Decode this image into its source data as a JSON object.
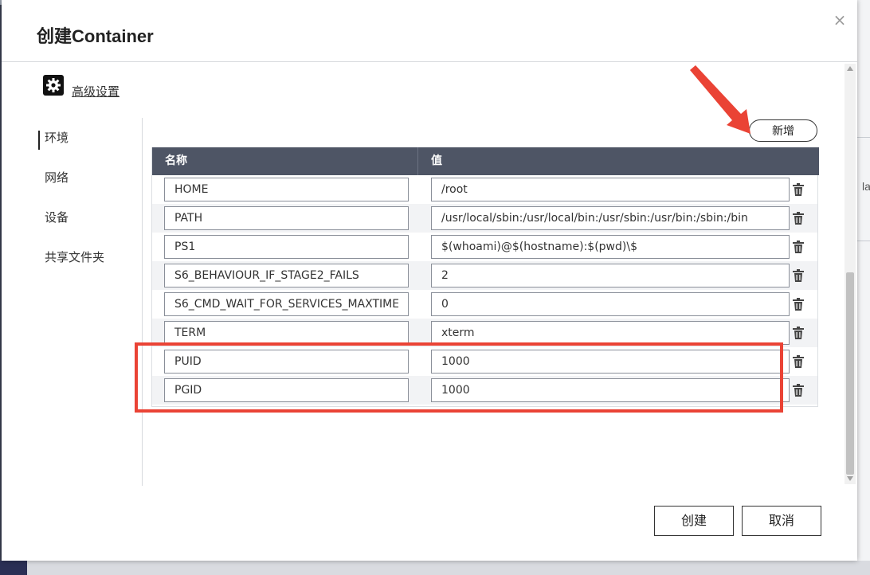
{
  "dialog": {
    "title": "创建Container",
    "close_label": "×"
  },
  "advanced": {
    "label": "高级设置",
    "icon": "gear-icon"
  },
  "sidebar": {
    "items": [
      {
        "label": "环境",
        "active": true
      },
      {
        "label": "网络",
        "active": false
      },
      {
        "label": "设备",
        "active": false
      },
      {
        "label": "共享文件夹",
        "active": false
      }
    ]
  },
  "env": {
    "add_label": "新增",
    "columns": {
      "name": "名称",
      "value": "值"
    },
    "rows": [
      {
        "name": "HOME",
        "value": "/root"
      },
      {
        "name": "PATH",
        "value": "/usr/local/sbin:/usr/local/bin:/usr/sbin:/usr/bin:/sbin:/bin"
      },
      {
        "name": "PS1",
        "value": "$(whoami)@$(hostname):$(pwd)\\$"
      },
      {
        "name": "S6_BEHAVIOUR_IF_STAGE2_FAILS",
        "value": "2"
      },
      {
        "name": "S6_CMD_WAIT_FOR_SERVICES_MAXTIME",
        "value": "0"
      },
      {
        "name": "TERM",
        "value": "xterm"
      },
      {
        "name": "PUID",
        "value": "1000"
      },
      {
        "name": "PGID",
        "value": "1000"
      }
    ]
  },
  "footer": {
    "create_label": "创建",
    "cancel_label": "取消"
  },
  "background": {
    "right_fragment": "la"
  },
  "colors": {
    "header_bg": "#4e5565",
    "annotation": "#ea4335"
  }
}
